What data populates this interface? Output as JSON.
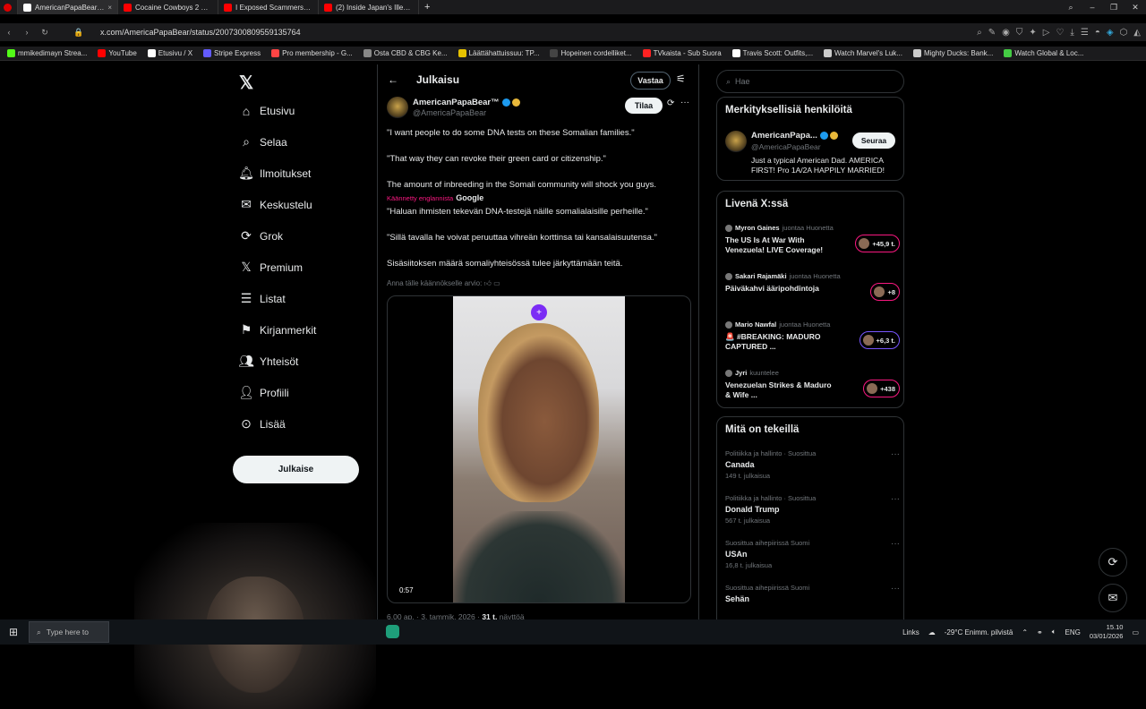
{
  "browser": {
    "tabs": [
      {
        "title": "AmericanPapaBear™ X.com",
        "icon": "x-icon",
        "color": "#ffffff",
        "active": true
      },
      {
        "title": "Cocaine Cowboys 2 Hustl",
        "icon": "youtube-icon",
        "color": "#ff0000",
        "active": false
      },
      {
        "title": "I Exposed Scammers in To",
        "icon": "youtube-icon",
        "color": "#ff0000",
        "active": false
      },
      {
        "title": "(2) Inside Japan's Illegal Dr",
        "icon": "youtube-icon",
        "color": "#ff0000",
        "active": false
      }
    ],
    "url": "x.com/AmericaPapaBear/status/2007300809559135764",
    "bookmarks": [
      {
        "label": "mmikedimayn Strea...",
        "color": "#53fc18"
      },
      {
        "label": "YouTube",
        "color": "#ff0000"
      },
      {
        "label": "Etusivu / X",
        "color": "#ffffff"
      },
      {
        "label": "Stripe Express",
        "color": "#635bff"
      },
      {
        "label": "Pro membership - G...",
        "color": "#ff4444"
      },
      {
        "label": "Osta CBD & CBG Ke...",
        "color": "#888888"
      },
      {
        "label": "Läättähattuissuu: TP...",
        "color": "#e6c200"
      },
      {
        "label": "Hopeinen cordelliket...",
        "color": "#444444"
      },
      {
        "label": "TVkaista - Sub Suora",
        "color": "#ff2222"
      },
      {
        "label": "Travis Scott: Outfits,...",
        "color": "#ffffff"
      },
      {
        "label": "Watch Marvel's Luk...",
        "color": "#cccccc"
      },
      {
        "label": "Mighty Ducks: Bank...",
        "color": "#cccccc"
      },
      {
        "label": "Watch Global & Loc...",
        "color": "#44cc44"
      }
    ]
  },
  "sidebar": {
    "items": [
      {
        "label": "Etusivu",
        "icon": "home-icon"
      },
      {
        "label": "Selaa",
        "icon": "search-icon"
      },
      {
        "label": "Ilmoitukset",
        "icon": "bell-icon"
      },
      {
        "label": "Keskustelu",
        "icon": "mail-icon"
      },
      {
        "label": "Grok",
        "icon": "grok-icon"
      },
      {
        "label": "Premium",
        "icon": "x-premium-icon"
      },
      {
        "label": "Listat",
        "icon": "list-icon"
      },
      {
        "label": "Kirjanmerkit",
        "icon": "bookmark-icon"
      },
      {
        "label": "Yhteisöt",
        "icon": "communities-icon"
      },
      {
        "label": "Profiili",
        "icon": "profile-icon"
      },
      {
        "label": "Lisää",
        "icon": "more-circle-icon"
      }
    ],
    "post_button": "Julkaise"
  },
  "post": {
    "header_title": "Julkaisu",
    "reply_button": "Vastaa",
    "author_name": "AmericanPapaBear™",
    "author_handle": "@AmericaPapaBear",
    "subscribe_button": "Tilaa",
    "lines": [
      "\"I want people to do some DNA tests on these Somalian families.\"",
      "\"That way they can revoke their green card or citizenship.\"",
      "The amount of inbreeding in the Somali community will shock you guys."
    ],
    "translated_from": "Käännetty englannista",
    "translated_by": "Google",
    "translated_lines": [
      "\"Haluan ihmisten tekevän DNA-testejä näille somalialaisille perheille.\"",
      "\"Sillä tavalla he voivat peruuttaa vihreän korttinsa tai kansalaisuutensa.\"",
      "Sisäsiitoksen määrä somaliyhteisössä tulee järkyttämään teitä."
    ],
    "rate_translation": "Anna tälle käännökselle arvio:",
    "video_time": "0:57",
    "meta_time": "6.00 ap. · 3. tammik. 2026 · ",
    "meta_views_count": "31 t.",
    "meta_views_label": " näyttöä"
  },
  "right": {
    "search_placeholder": "Hae",
    "relevant": {
      "title": "Merkityksellisiä henkilöitä",
      "name": "AmericanPapa...",
      "handle": "@AmericaPapaBear",
      "follow": "Seuraa",
      "bio": "Just a typical American Dad. AMERICA FIRST! Pro 1A/2A HAPPILY MARRIED!"
    },
    "live": {
      "title": "Livenä X:ssä",
      "items": [
        {
          "host": "Myron Gaines",
          "role": "juontaa Huonetta",
          "title": "The US Is At War With Venezuela! LIVE Coverage!",
          "count": "+45,9 t."
        },
        {
          "host": "Sakari Rajamäki",
          "role": "juontaa Huonetta",
          "title": "Päiväkahvi ääripohdintoja",
          "count": "+8"
        },
        {
          "host": "Mario Nawfal",
          "role": "juontaa Huonetta",
          "title": "🚨 #BREAKING: MADURO CAPTURED ...",
          "count": "+6,3 t."
        },
        {
          "host": "Jyri",
          "role": "kuuntelee",
          "title": "Venezuelan Strikes & Maduro & Wife ...",
          "count": "+438"
        }
      ]
    },
    "trends": {
      "title": "Mitä on tekeillä",
      "items": [
        {
          "category": "Politiikka ja hallinto · Suosittua",
          "topic": "Canada",
          "count": "149 t. julkaisua"
        },
        {
          "category": "Politiikka ja hallinto · Suosittua",
          "topic": "Donald Trump",
          "count": "567 t. julkaisua"
        },
        {
          "category": "Suosittua aihepiirissä Suomi",
          "topic": "USAn",
          "count": "16,8 t. julkaisua"
        },
        {
          "category": "Suosittua aihepiirissä Suomi",
          "topic": "Sehän",
          "count": ""
        }
      ]
    }
  },
  "taskbar": {
    "search_placeholder": "Type here to",
    "links": "Links",
    "weather": "-29°C  Enimm. pilvistä",
    "lang": "ENG",
    "time": "15.10",
    "date": "03/01/2026"
  }
}
